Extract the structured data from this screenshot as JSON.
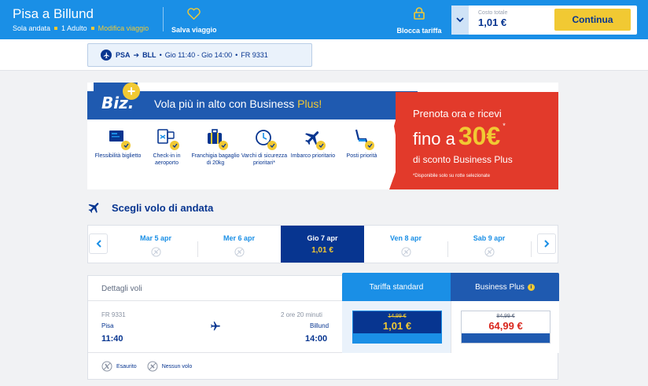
{
  "header": {
    "title": "Pisa a Billund",
    "trip_type": "Sola andata",
    "passengers": "1 Adulto",
    "modify_link": "Modifica viaggio",
    "save_trip": "Salva viaggio",
    "lock_fare": "Blocca tariffa",
    "total_label": "Costo totale",
    "total_value": "1,01 €",
    "continue": "Continua"
  },
  "flight_chip": {
    "origin": "PSA",
    "destination": "BLL",
    "times": "Gio 11:40 - Gio 14:00",
    "flight_number": "FR 9331"
  },
  "biz_banner": {
    "logo": "Biz.",
    "headline_main": "Vola più in alto con Business",
    "headline_plus": "Plus!",
    "perks": [
      {
        "label": "Flessibilità biglietto",
        "icon": "flexible-ticket-icon"
      },
      {
        "label": "Check-in in aeroporto",
        "icon": "airport-checkin-icon"
      },
      {
        "label": "Franchigia bagaglio di 20kg",
        "icon": "luggage-icon"
      },
      {
        "label": "Varchi di sicurezza prioritari*",
        "icon": "fast-track-icon"
      },
      {
        "label": "Imbarco prioritario",
        "icon": "priority-boarding-icon"
      },
      {
        "label": "Posti priorità",
        "icon": "seat-icon"
      }
    ],
    "promo_line1": "Prenota ora e ricevi",
    "promo_fino": "fino a",
    "promo_amount": "30€",
    "promo_star": "*",
    "promo_line3": "di sconto Business Plus",
    "promo_note": "*Disponibile solo su rotte selezionate"
  },
  "section": {
    "title": "Scegli volo di andata"
  },
  "dates": [
    {
      "label": "Mar 5 apr",
      "price": null
    },
    {
      "label": "Mer 6 apr",
      "price": null
    },
    {
      "label": "Gio 7 apr",
      "price": "1,01 €",
      "selected": true
    },
    {
      "label": "Ven 8 apr",
      "price": null
    },
    {
      "label": "Sab 9 apr",
      "price": null
    }
  ],
  "fares": {
    "details_label": "Dettagli voli",
    "tab_standard": "Tariffa standard",
    "tab_business": "Business Plus",
    "flight": {
      "code": "FR 9331",
      "duration": "2 ore 20 minuti",
      "from": "Pisa",
      "to": "Billund",
      "dep_time": "11:40",
      "arr_time": "14:00"
    },
    "standard": {
      "old_price": "14,99 €",
      "price": "1,01 €"
    },
    "business": {
      "old_price": "84,99 €",
      "price": "64,99 €"
    },
    "legend_soldout": "Esaurito",
    "legend_noflight": "Nessun volo"
  },
  "colors": {
    "brand_blue": "#1a8fe6",
    "navy": "#073590",
    "yellow": "#f1c933",
    "promo_red": "#e23a2b"
  }
}
